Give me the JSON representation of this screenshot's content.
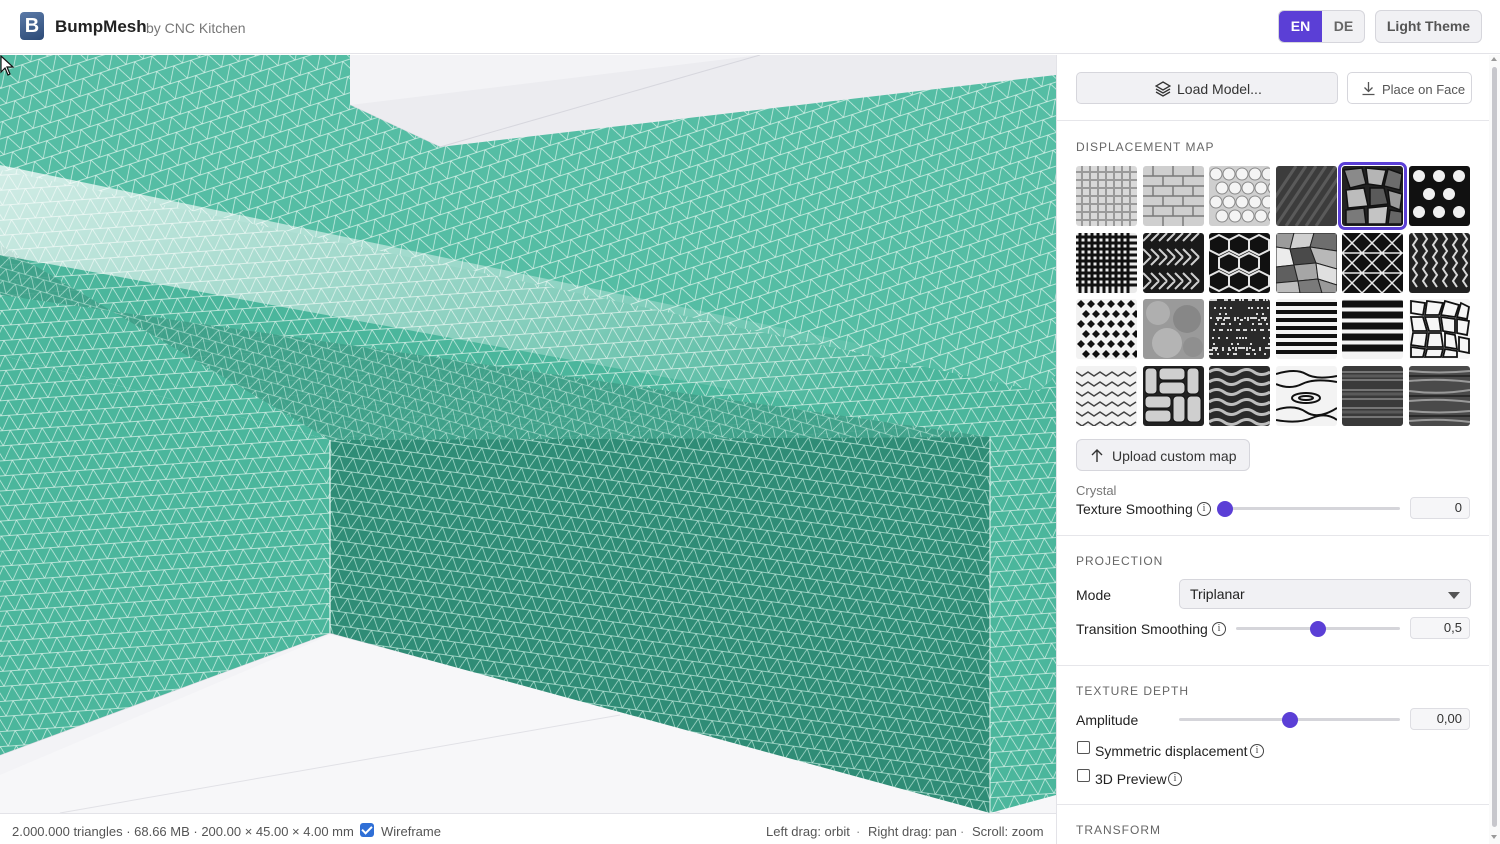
{
  "header": {
    "logo_letter": "B",
    "title": "BumpMesh",
    "subtitle": "by CNC Kitchen",
    "lang_en": "EN",
    "lang_de": "DE",
    "theme_button": "Light Theme"
  },
  "viewport": {
    "mesh_color": "#4fb9a0",
    "mesh_dark_color": "#2f8a74"
  },
  "statusbar": {
    "mesh_stats": "2.000.000 triangles · 68.66 MB · 200.00 × 45.00 × 4.00 mm",
    "wireframe_label": "Wireframe",
    "wireframe_checked": true,
    "hint_orbit": "Left drag: orbit",
    "hint_pan": "Right drag: pan",
    "hint_zoom": "Scroll: zoom",
    "separator": "·"
  },
  "sidebar": {
    "load_model": "Load Model...",
    "place_on_face": "Place on Face",
    "displacement_map_title": "DISPLACEMENT MAP",
    "textures": [
      "grid-mesh",
      "bricks",
      "circles",
      "carbon-fiber",
      "crystal",
      "dots",
      "knit-grid",
      "herringbone",
      "hexagons",
      "voronoi-gray",
      "triangles",
      "knit-vertical",
      "diamond-dots",
      "noise-soft",
      "noise-grain",
      "stripes-thin",
      "stripes-thick",
      "voronoi-cells",
      "weave-zigzag",
      "basket-weave",
      "wavy-lines",
      "wood-grain",
      "wood-dark",
      "wood-rough"
    ],
    "selected_texture": "crystal",
    "upload_custom_map": "Upload custom map",
    "selected_name": "Crystal",
    "texture_smoothing_label": "Texture Smoothing",
    "texture_smoothing_value": "0",
    "texture_smoothing_level": 0,
    "projection_title": "PROJECTION",
    "mode_label": "Mode",
    "mode_value": "Triplanar",
    "transition_smoothing_label": "Transition Smoothing",
    "transition_smoothing_value": "0,5",
    "transition_smoothing_level": 0.5,
    "texture_depth_title": "TEXTURE DEPTH",
    "amplitude_label": "Amplitude",
    "amplitude_value": "0,00",
    "amplitude_level": 0.5,
    "symmetric_label": "Symmetric displacement",
    "symmetric_checked": false,
    "preview3d_label": "3D Preview",
    "preview3d_checked": false,
    "transform_title": "TRANSFORM",
    "accent_color": "#5b3fd6",
    "info_glyph": "i"
  }
}
